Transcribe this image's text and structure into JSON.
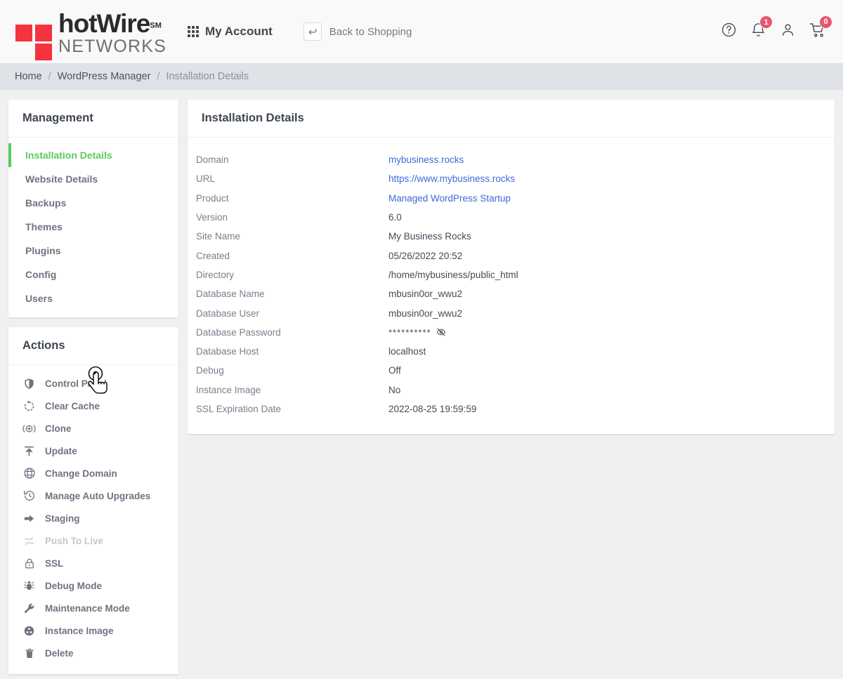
{
  "header": {
    "logo": {
      "name_top": "hotWire",
      "trademark": "SM",
      "name_bottom": "NETWORKS"
    },
    "nav": {
      "my_account": "My Account",
      "grid_icon": "grid-icon"
    },
    "back_to_shopping": {
      "label": "Back to Shopping",
      "icon": "return-arrow-icon"
    },
    "icons": [
      {
        "name": "help-icon",
        "badge": null
      },
      {
        "name": "notifications-bell-icon",
        "badge": "1"
      },
      {
        "name": "user-account-icon",
        "badge": null
      },
      {
        "name": "shopping-cart-icon",
        "badge": "0"
      }
    ],
    "badge_color": "#e8556d"
  },
  "breadcrumb": {
    "items": [
      {
        "label": "Home",
        "current": false
      },
      {
        "label": "WordPress Manager",
        "current": false
      },
      {
        "label": "Installation Details",
        "current": true
      }
    ],
    "separator": "/"
  },
  "management": {
    "title": "Management",
    "active_color": "#5cc95c",
    "items": [
      {
        "label": "Installation Details",
        "active": true
      },
      {
        "label": "Website Details",
        "active": false
      },
      {
        "label": "Backups",
        "active": false
      },
      {
        "label": "Themes",
        "active": false
      },
      {
        "label": "Plugins",
        "active": false
      },
      {
        "label": "Config",
        "active": false
      },
      {
        "label": "Users",
        "active": false
      }
    ]
  },
  "actions": {
    "title": "Actions",
    "items": [
      {
        "label": "Control Panel",
        "icon": "shield-icon",
        "disabled": false
      },
      {
        "label": "Clear Cache",
        "icon": "refresh-icon",
        "disabled": false
      },
      {
        "label": "Clone",
        "icon": "clone-icon",
        "disabled": false
      },
      {
        "label": "Update",
        "icon": "upload-arrow-icon",
        "disabled": false
      },
      {
        "label": "Change Domain",
        "icon": "globe-icon",
        "disabled": false
      },
      {
        "label": "Manage Auto Upgrades",
        "icon": "history-clock-icon",
        "disabled": false
      },
      {
        "label": "Staging",
        "icon": "arrow-right-icon",
        "disabled": false
      },
      {
        "label": "Push To Live",
        "icon": "swap-arrows-icon",
        "disabled": true
      },
      {
        "label": "SSL",
        "icon": "lock-icon",
        "disabled": false
      },
      {
        "label": "Debug Mode",
        "icon": "bug-icon",
        "disabled": false
      },
      {
        "label": "Maintenance Mode",
        "icon": "wrench-icon",
        "disabled": false
      },
      {
        "label": "Instance Image",
        "icon": "instance-image-icon",
        "disabled": false
      },
      {
        "label": "Delete",
        "icon": "trash-icon",
        "disabled": false
      }
    ]
  },
  "installation_details": {
    "title": "Installation Details",
    "link_color": "#3f6ad8",
    "rows": [
      {
        "label": "Domain",
        "value": "mybusiness.rocks",
        "type": "link"
      },
      {
        "label": "URL",
        "value": "https://www.mybusiness.rocks",
        "type": "link"
      },
      {
        "label": "Product",
        "value": "Managed WordPress Startup",
        "type": "link"
      },
      {
        "label": "Version",
        "value": "6.0",
        "type": "text"
      },
      {
        "label": "Site Name",
        "value": "My Business Rocks",
        "type": "text"
      },
      {
        "label": "Created",
        "value": "05/26/2022 20:52",
        "type": "text"
      },
      {
        "label": "Directory",
        "value": "/home/mybusiness/public_html",
        "type": "text"
      },
      {
        "label": "Database Name",
        "value": "mbusin0or_wwu2",
        "type": "text"
      },
      {
        "label": "Database User",
        "value": "mbusin0or_wwu2",
        "type": "text"
      },
      {
        "label": "Database Password",
        "value": "**********",
        "type": "password",
        "toggle_icon": "eye-slash-icon"
      },
      {
        "label": "Database Host",
        "value": "localhost",
        "type": "text"
      },
      {
        "label": "Debug",
        "value": "Off",
        "type": "text"
      },
      {
        "label": "Instance Image",
        "value": "No",
        "type": "text"
      },
      {
        "label": "SSL Expiration Date",
        "value": "2022-08-25 19:59:59",
        "type": "text"
      }
    ]
  },
  "cursor": {
    "icon": "hand-pointer-cursor",
    "over": "Control Panel"
  }
}
